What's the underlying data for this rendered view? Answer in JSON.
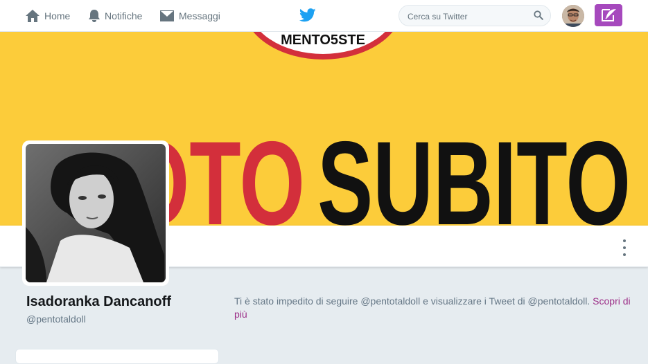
{
  "nav": {
    "home_label": "Home",
    "notifications_label": "Notifiche",
    "messages_label": "Messaggi"
  },
  "search": {
    "placeholder": "Cerca su Twitter"
  },
  "banner": {
    "hashtag_red": "#VOTO",
    "hashtag_black": "SUBITO",
    "logo_text": "MENTO5STE",
    "colors": {
      "background": "#fccc3a",
      "red": "#d32f3b",
      "black": "#111111"
    }
  },
  "profile": {
    "name": "Isadoranka Dancanoff",
    "handle": "@pentotaldoll"
  },
  "notice": {
    "text": "Ti è stato impedito di seguire @pentotaldoll e visualizzare i Tweet di @pentotaldoll.",
    "link_label": "Scopri di più"
  },
  "colors": {
    "accent": "#a649bd",
    "twitter_blue": "#1da1f2",
    "link": "#9c2e87"
  }
}
